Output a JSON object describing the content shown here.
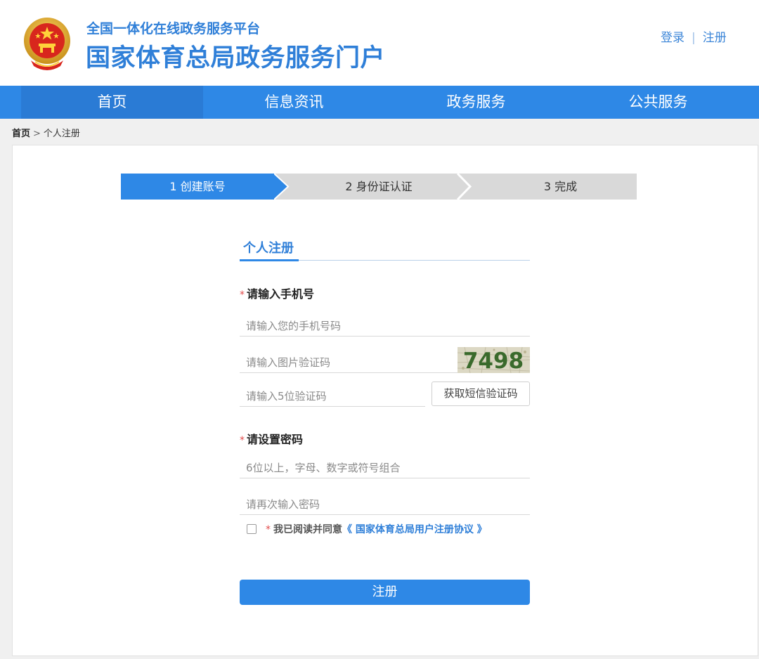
{
  "header": {
    "sub_title": "全国一体化在线政务服务平台",
    "main_title": "国家体育总局政务服务门户",
    "login_label": "登录",
    "separator": "|",
    "register_label": "注册"
  },
  "nav": {
    "items": [
      {
        "label": "首页",
        "active": true
      },
      {
        "label": "信息资讯",
        "active": false
      },
      {
        "label": "政务服务",
        "active": false
      },
      {
        "label": "公共服务",
        "active": false
      }
    ]
  },
  "breadcrumb": {
    "home": "首页",
    "separator": ">",
    "current": "个人注册"
  },
  "steps": [
    {
      "label": "1 创建账号",
      "active": true
    },
    {
      "label": "2 身份证认证",
      "active": false
    },
    {
      "label": "3 完成",
      "active": false
    }
  ],
  "form": {
    "tab_label": "个人注册",
    "required_mark": "*",
    "phone_label": "请输入手机号",
    "phone_placeholder": "请输入您的手机号码",
    "captcha_placeholder": "请输入图片验证码",
    "captcha_text": "7498",
    "sms_placeholder": "请输入5位验证码",
    "sms_button": "获取短信验证码",
    "password_label": "请设置密码",
    "password_placeholder": "6位以上，字母、数字或符号组合",
    "password_confirm_placeholder": "请再次输入密码",
    "agree_text": "我已阅读并同意",
    "agree_link": "《 国家体育总局用户注册协议 》",
    "agree_checked": false,
    "submit_label": "注册"
  },
  "colors": {
    "brand_blue": "#2e88e6",
    "title_blue": "#2f7fd8",
    "required_red": "#e24b4b",
    "step_inactive": "#d9d9d9"
  }
}
